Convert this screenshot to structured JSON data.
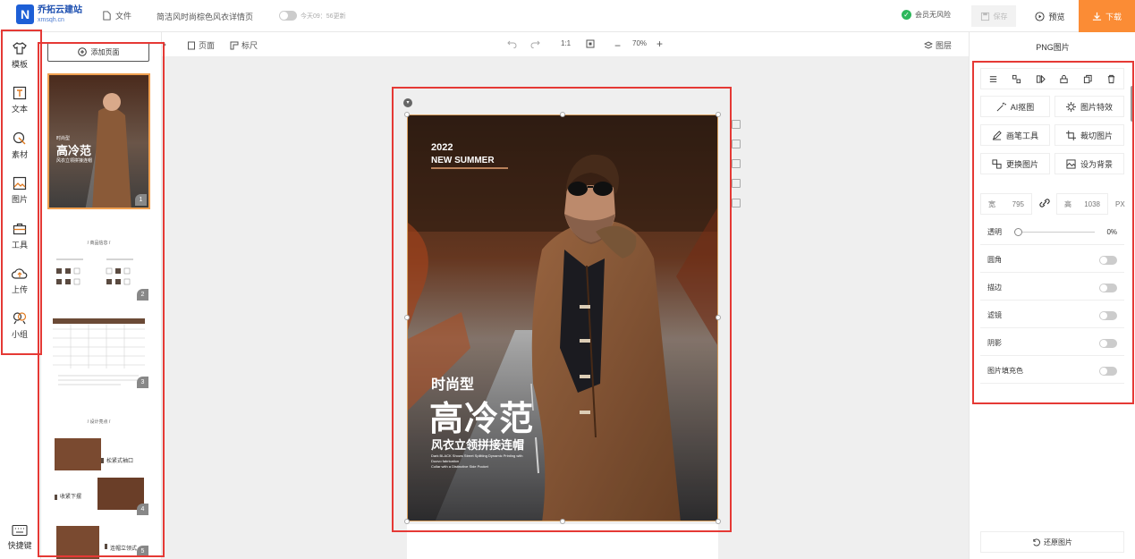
{
  "topbar": {
    "logo_letter": "N",
    "logo_name": "乔拓云建站",
    "logo_domain": "xmsqh.cn",
    "file_label": "文件",
    "doc_title": "简洁风时尚棕色风衣详情页",
    "autosave_text": "今天09：56更新",
    "vip_label": "会员无风险",
    "save_label": "保存",
    "preview_label": "预览",
    "download_label": "下载"
  },
  "sidebar": {
    "items": [
      {
        "label": "模板"
      },
      {
        "label": "文本"
      },
      {
        "label": "素材"
      },
      {
        "label": "图片"
      },
      {
        "label": "工具"
      },
      {
        "label": "上传"
      },
      {
        "label": "小组"
      }
    ],
    "shortcut_label": "快捷键"
  },
  "pages_panel": {
    "add_page_label": "添加页面",
    "thumbs": [
      {
        "num": "1",
        "line1": "时尚型",
        "line2": "高冷范",
        "line3": "风衣立领拼接连帽"
      },
      {
        "num": "2",
        "heading": "/ 商品信息 /"
      },
      {
        "num": "3"
      },
      {
        "num": "4",
        "heading": "/ 设计亮点 /",
        "label_a": "松紧式袖口",
        "label_b": "收紧下摆"
      },
      {
        "num": "5",
        "label_a": "连帽立领式"
      }
    ]
  },
  "canvas_toolbar": {
    "page_label": "页面",
    "ruler_label": "标尺",
    "ratio_label": "1:1",
    "zoom": "70%",
    "layers_label": "图层"
  },
  "poster": {
    "year": "2022",
    "season": "NEW SUMMER",
    "line1": "时尚型",
    "line2": "高冷范",
    "line3": "风衣立领拼接连帽",
    "small1": "Dark BLACK Shows Street Splitting Dynamic Printing with",
    "small2": "Duovo fabrication",
    "small3": "Collar with a Distinctive Side Pocket"
  },
  "props": {
    "title": "PNG图片",
    "buttons": {
      "ai_cutout": "AI抠图",
      "effects": "图片特效",
      "brush": "画笔工具",
      "crop": "裁切图片",
      "replace": "更换图片",
      "set_bg": "设为背景"
    },
    "width_label": "宽",
    "width_value": "795",
    "height_label": "高",
    "height_value": "1038",
    "unit": "PX",
    "opacity_label": "透明",
    "opacity_value": "0%",
    "rows": [
      "圆角",
      "描边",
      "滤镜",
      "阴影",
      "图片填充色"
    ],
    "restore_label": "还原图片"
  },
  "colors": {
    "accent": "#fb8c35",
    "brand": "#1d5fd6",
    "highlight": "#e53935"
  }
}
